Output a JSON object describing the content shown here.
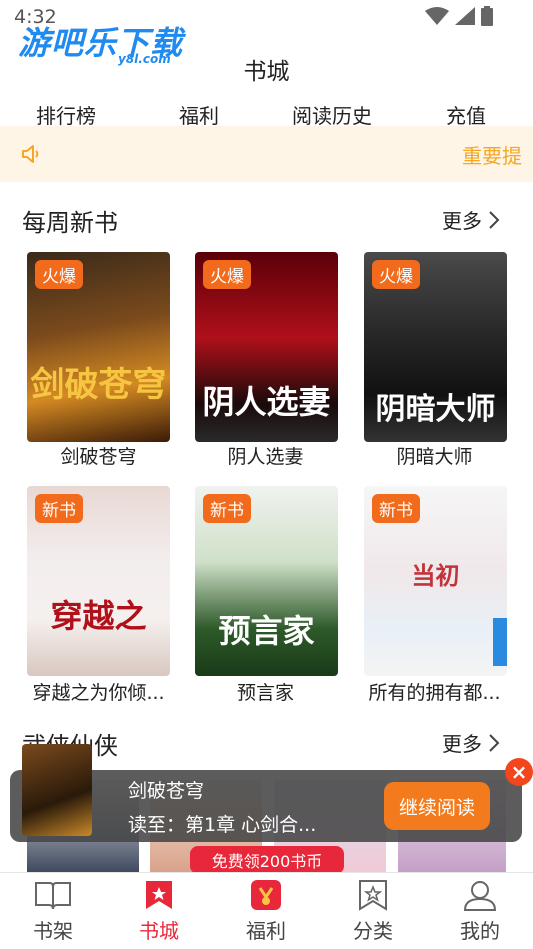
{
  "status": {
    "time": "4:32"
  },
  "logo": {
    "main": "游吧乐下载",
    "sub": "y8l.com"
  },
  "header": {
    "title": "书城"
  },
  "topnav": {
    "items": [
      "排行榜",
      "福利",
      "阅读历史",
      "充值"
    ]
  },
  "notice": {
    "text": "重要提"
  },
  "weekly": {
    "title": "每周新书",
    "more": "更多",
    "books": [
      {
        "name": "剑破苍穹",
        "tag": "火爆",
        "cover_text": "剑破苍穹"
      },
      {
        "name": "阴人选妻",
        "tag": "火爆",
        "cover_text": "阴人选妻"
      },
      {
        "name": "阴暗大师",
        "tag": "火爆",
        "cover_text": "阴暗大师"
      },
      {
        "name": "穿越之为你倾...",
        "tag": "新书",
        "cover_text": "穿越之"
      },
      {
        "name": "预言家",
        "tag": "新书",
        "cover_text": "预言家"
      },
      {
        "name": "所有的拥有都...",
        "tag": "新书",
        "cover_text": "当初"
      }
    ]
  },
  "wuxia": {
    "title": "武侠仙侠",
    "more": "更多"
  },
  "overlay": {
    "book": "剑破苍穹",
    "reading": "读至：第1章 心剑合...",
    "continue": "继续阅读",
    "close": "×",
    "free": "免费领200书币"
  },
  "tabbar": {
    "items": [
      {
        "label": "书架",
        "icon": "book-open-icon"
      },
      {
        "label": "书城",
        "icon": "bookmark-star-icon"
      },
      {
        "label": "福利",
        "icon": "gift-icon"
      },
      {
        "label": "分类",
        "icon": "category-icon"
      },
      {
        "label": "我的",
        "icon": "user-icon"
      }
    ],
    "active": "书城"
  },
  "colors": {
    "accent": "#e8283a",
    "tag": "#f26a1b",
    "notice": "#f5a623"
  }
}
